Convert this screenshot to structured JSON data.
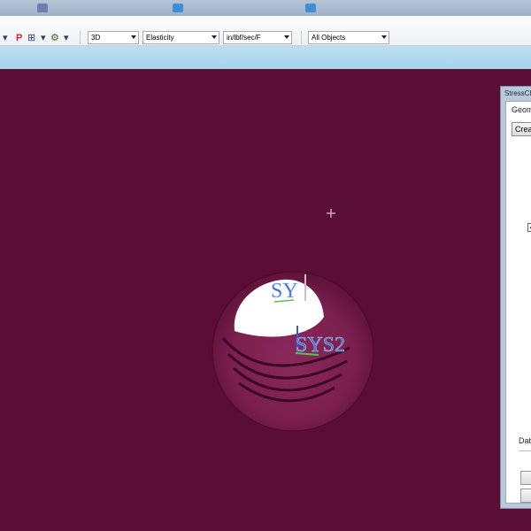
{
  "toolbar": {
    "icons": [
      {
        "name": "dropdown-caret-icon",
        "glyph": "▾"
      },
      {
        "name": "p-icon",
        "glyph": "P"
      },
      {
        "name": "load-icon",
        "glyph": "⊞"
      },
      {
        "name": "dropdown-caret-icon",
        "glyph": "▾"
      },
      {
        "name": "tool-icon",
        "glyph": "⚙"
      },
      {
        "name": "dropdown-caret-icon",
        "glyph": "▾"
      }
    ],
    "view_mode": "3D",
    "analysis_type": "Elasticity",
    "units": "in/lbf/sec/F",
    "object_filter": "All Objects"
  },
  "viewport": {
    "labels": {
      "sys1": "SY",
      "sys2": "SYS2"
    },
    "colors": {
      "background": "#5a0d35",
      "label": "#3b6fd1",
      "axis_green": "#4fc94a",
      "axis_blue": "#2e62d8"
    }
  },
  "panel": {
    "title": "StressCh",
    "tab": "Geom",
    "create_button": "Creat",
    "checkbox_mark": "✓",
    "data_label": "Data"
  }
}
